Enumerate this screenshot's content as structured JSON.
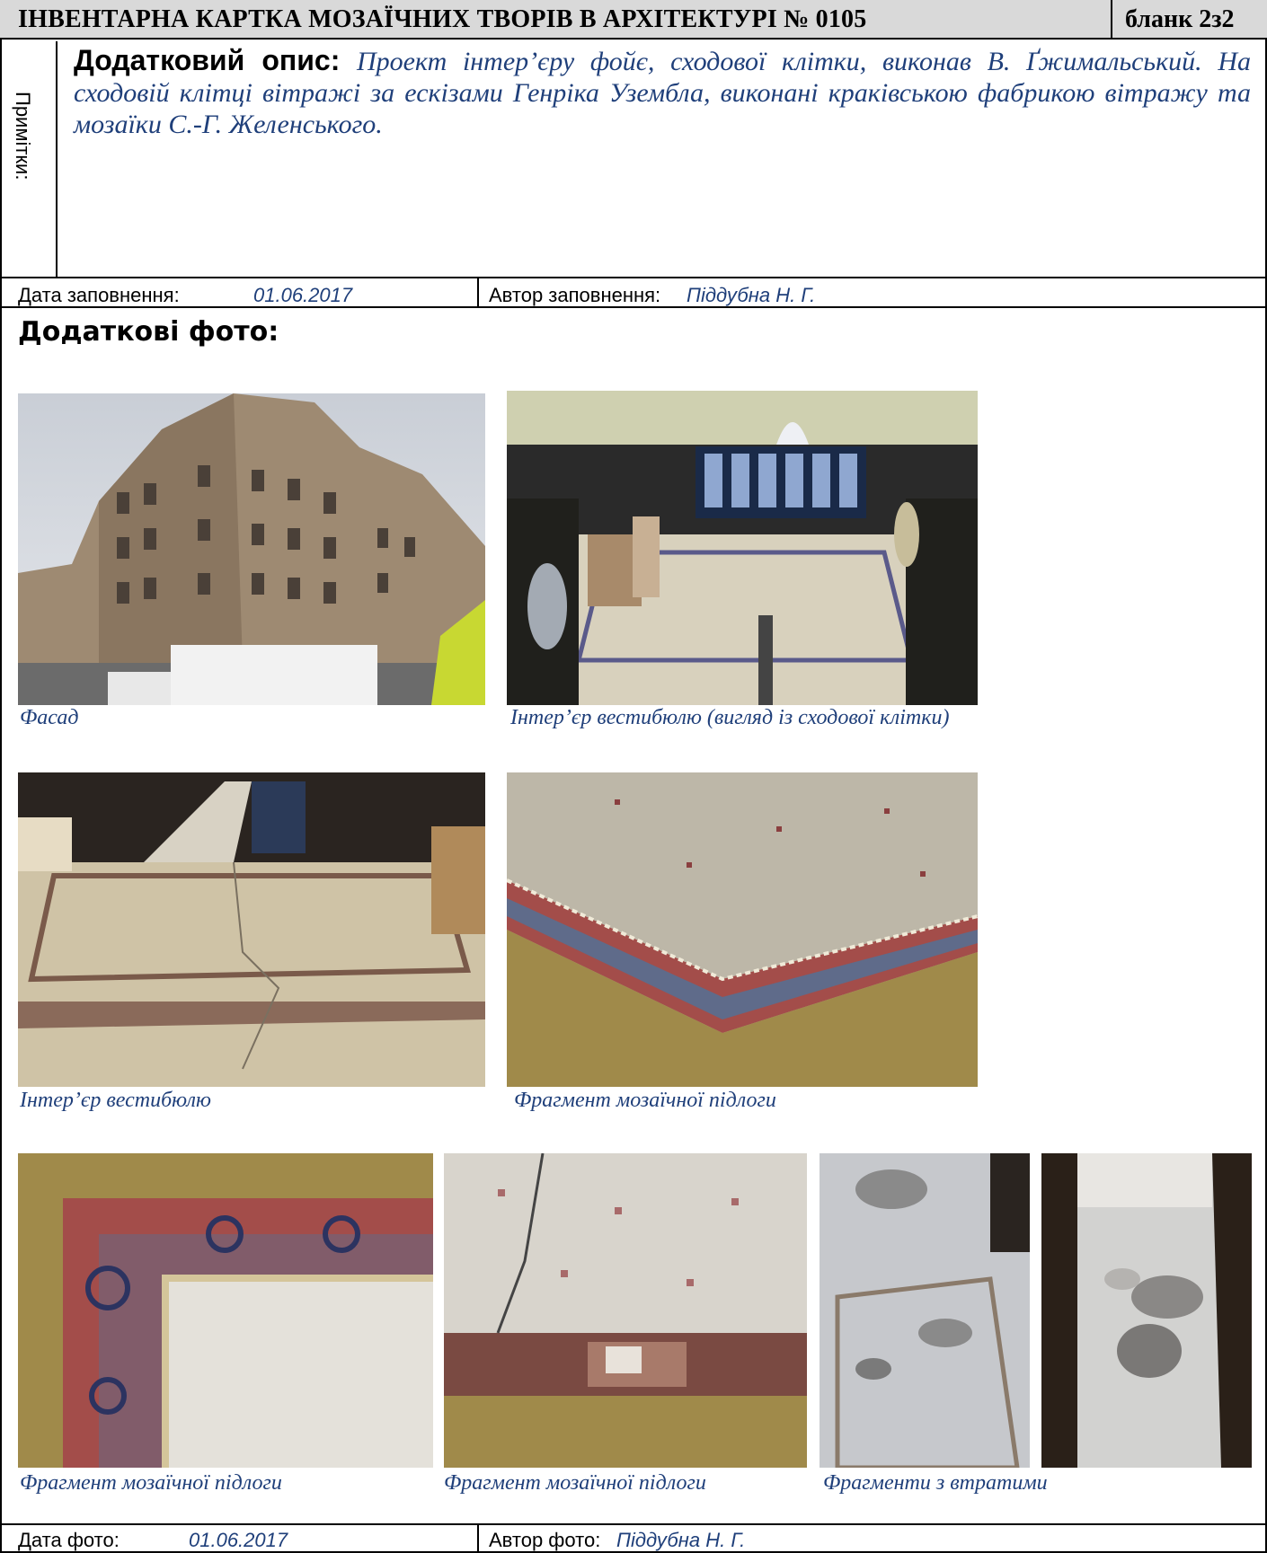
{
  "header": {
    "title": "ІНВЕНТАРНА КАРТКА  МОЗАЇЧНИХ ТВОРІВ В АРХІТЕКТУРІ № 0105",
    "blank": "бланк 2з2"
  },
  "notes": {
    "side_label": "Примітки:",
    "heading": "Додатковий опис:",
    "text": "Проект інтер’єру фойє, сходової клітки, виконав В. Ґжимальський. На сходовій клітці вітражі за ескізами Генріка Узембла, виконані краківською фабрикою вітражу та мозаїки С.-Г. Желенського."
  },
  "fill": {
    "date_label": "Дата заповнення:",
    "date_value": "01.06.2017",
    "author_label": "Автор заповнення:",
    "author_value": "Піддубна Н. Г."
  },
  "extra_photos": {
    "title": "Додаткові фото:",
    "captions": [
      "Фасад",
      "Інтер’єр вестибюлю (вигляд із сходової клітки)",
      "Інтер’єр вестибюлю",
      "Фрагмент мозаїчної підлоги",
      "Фрагмент мозаїчної підлоги",
      "Фрагмент мозаїчної підлоги",
      "Фрагменти з втратими"
    ]
  },
  "photo_footer": {
    "date_label": "Дата фото:",
    "date_value": "01.06.2017",
    "author_label": "Автор фото:",
    "author_value": "Піддубна Н. Г."
  }
}
